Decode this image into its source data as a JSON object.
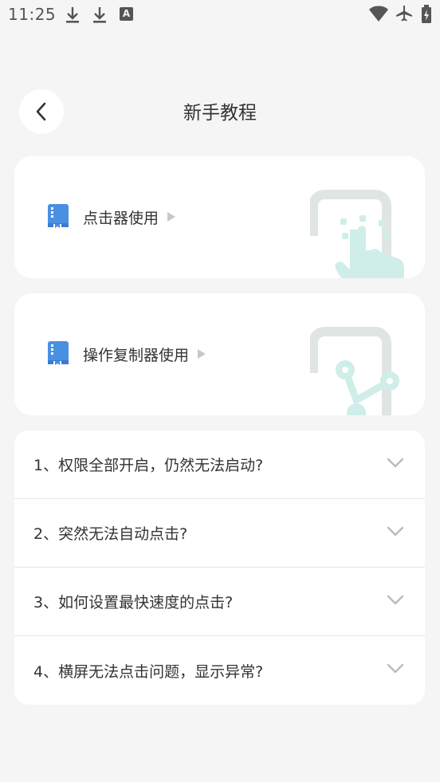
{
  "status_bar": {
    "time": "11:25",
    "icons": [
      "download-icon",
      "download-icon",
      "text-a-icon",
      "wifi-icon",
      "airplane-icon",
      "battery-charging-icon"
    ],
    "a_glyph": "A"
  },
  "header": {
    "title": "新手教程"
  },
  "cards": [
    {
      "label": "点击器使用",
      "icon": "book-icon",
      "illustration": "tap-hand-illustration"
    },
    {
      "label": "操作复制器使用",
      "icon": "book-icon",
      "illustration": "share-nodes-illustration"
    }
  ],
  "faq": [
    {
      "text": "1、权限全部开启，仍然无法启动?"
    },
    {
      "text": "2、突然无法自动点击?"
    },
    {
      "text": "3、如何设置最快速度的点击?"
    },
    {
      "text": "4、横屏无法点击问题，显示异常?"
    }
  ],
  "colors": {
    "background": "#f5f5f5",
    "card": "#ffffff",
    "accent_blue": "#4a90e2",
    "illustration_gray": "#dfe5e3",
    "illustration_teal": "#cfeeea",
    "chevron": "#bbbbbb"
  }
}
